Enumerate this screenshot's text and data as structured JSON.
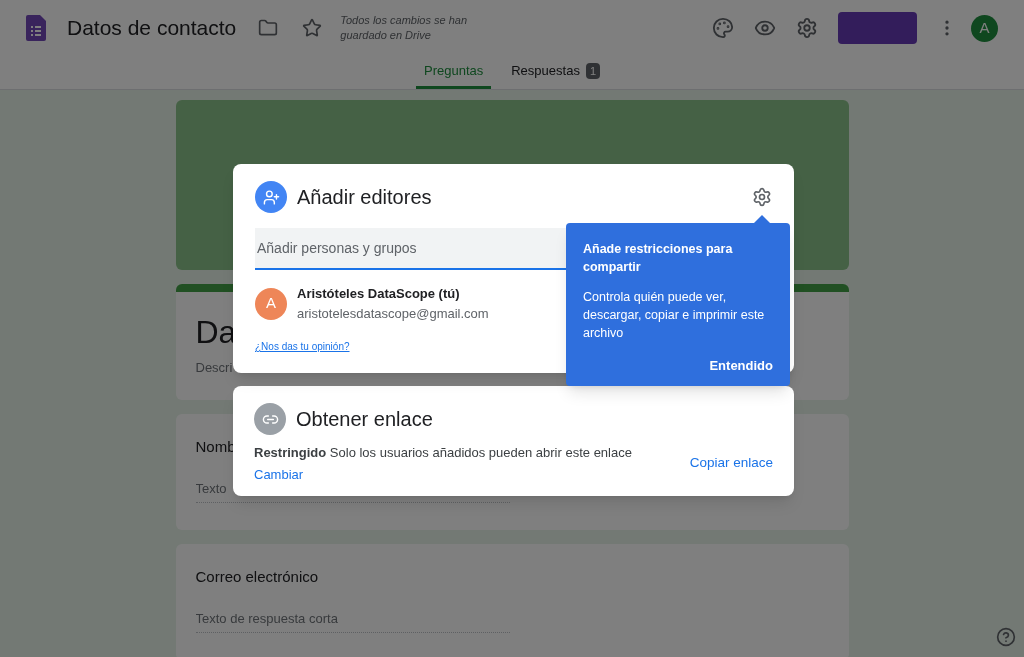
{
  "header": {
    "title": "Datos de contacto",
    "save_status": "Todos los cambios se han guardado en Drive",
    "account_initial": "A"
  },
  "tabs": [
    {
      "label": "Preguntas",
      "selected": true
    },
    {
      "label": "Respuestas",
      "selected": false,
      "badge": "1"
    }
  ],
  "form": {
    "title_card": {
      "title": "Da",
      "description": "Descri"
    },
    "questions": [
      {
        "title": "Nomb",
        "placeholder": "Texto"
      },
      {
        "title": "Correo electrónico",
        "placeholder": "Texto de respuesta corta"
      }
    ]
  },
  "share_dialog": {
    "title": "Añadir editores",
    "placeholder": "Añadir personas y grupos",
    "people": [
      {
        "initial": "A",
        "name": "Aristóteles DataScope (tú)",
        "email": "aristotelesdatascope@gmail.com",
        "color": "#ee8658"
      }
    ],
    "feedback_link": "¿Nos das tu opinión?"
  },
  "tooltip": {
    "title": "Añade restricciones para compartir",
    "body": "Controla quién puede ver, descargar, copiar e imprimir este archivo",
    "button": "Entendido"
  },
  "link_dialog": {
    "title": "Obtener enlace",
    "access": "**Restringido** Solo los usuarios añadidos pueden abrir este enlace",
    "change_link": "Cambiar",
    "copy_button": "Copiar enlace"
  }
}
